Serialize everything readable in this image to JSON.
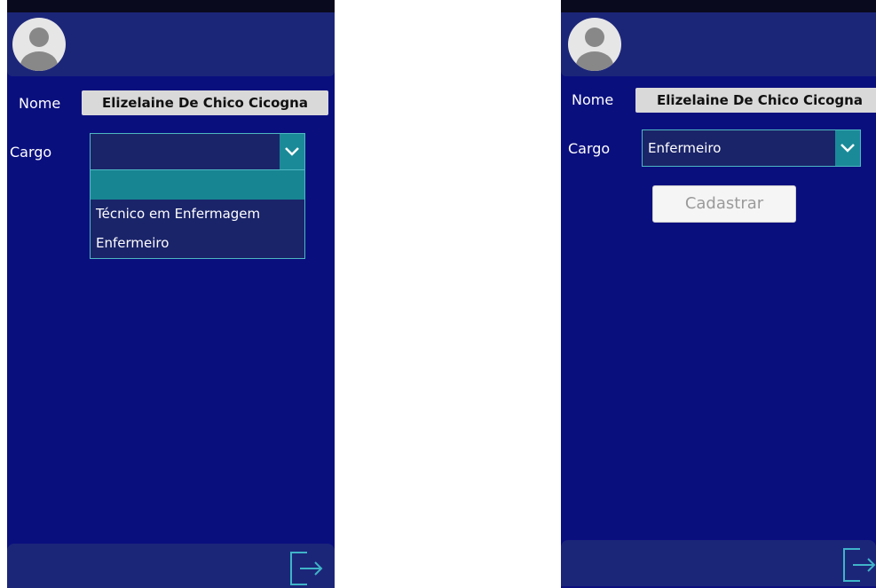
{
  "left_screen": {
    "nome_label": "Nome",
    "nome_value": "Elizelaine De Chico Cicogna",
    "cargo_label": "Cargo",
    "cargo_value": "",
    "options": [
      {
        "label": ""
      },
      {
        "label": "Técnico em Enfermagem"
      },
      {
        "label": "Enfermeiro"
      }
    ]
  },
  "right_screen": {
    "nome_label": "Nome",
    "nome_value": "Elizelaine De Chico Cicogna",
    "cargo_label": "Cargo",
    "cargo_value": "Enfermeiro",
    "submit_label": "Cadastrar"
  },
  "icons": {
    "avatar": "user-avatar-icon",
    "dropdown": "chevron-down-icon",
    "exit": "exit-icon"
  },
  "colors": {
    "background": "#0a0f7e",
    "bar": "#1c2679",
    "accent": "#1a8a98",
    "highlight": "#188593",
    "border": "#4db8c2"
  }
}
